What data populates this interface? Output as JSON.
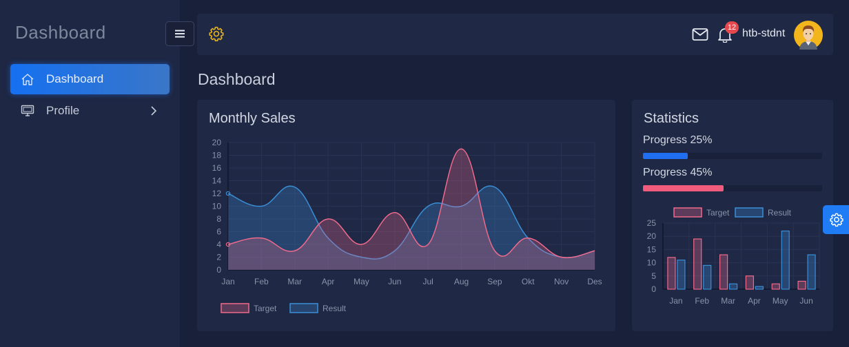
{
  "sidebar": {
    "brand": "Dashboard",
    "items": [
      {
        "label": "Dashboard",
        "icon": "home-icon",
        "active": true
      },
      {
        "label": "Profile",
        "icon": "monitor-icon",
        "active": false
      }
    ]
  },
  "header": {
    "username": "htb-stdnt",
    "notification_count": "12"
  },
  "page": {
    "title": "Dashboard"
  },
  "sales": {
    "title": "Monthly Sales",
    "legend": [
      "Target",
      "Result"
    ]
  },
  "stats": {
    "title": "Statistics",
    "progress": [
      {
        "label": "Progress 25%",
        "value": 0.25,
        "color": "#1f6ff0"
      },
      {
        "label": "Progress 45%",
        "value": 0.45,
        "color": "#f15b7c"
      }
    ],
    "legend": [
      "Target",
      "Result"
    ]
  },
  "colors": {
    "accent": "#1f7cf5",
    "target": "#f06a8c",
    "result": "#3a8fd8"
  },
  "chart_data": [
    {
      "type": "area",
      "categories": [
        "Jan",
        "Feb",
        "Mar",
        "Apr",
        "May",
        "Jun",
        "Jul",
        "Aug",
        "Sep",
        "Okt",
        "Nov",
        "Des"
      ],
      "series": [
        {
          "name": "Target",
          "values": [
            4,
            5,
            3,
            8,
            4,
            9,
            4,
            19,
            3,
            5,
            2,
            3
          ]
        },
        {
          "name": "Result",
          "values": [
            12,
            10,
            13,
            5,
            2,
            3,
            10,
            10,
            13,
            5,
            2,
            3
          ]
        }
      ],
      "yticks": [
        0,
        2,
        4,
        6,
        8,
        10,
        12,
        14,
        16,
        18,
        20
      ],
      "ylim": [
        0,
        20
      ],
      "grid": true,
      "legend_position": "bottom-left"
    },
    {
      "type": "bar",
      "categories": [
        "Jan",
        "Feb",
        "Mar",
        "Apr",
        "May",
        "Jun"
      ],
      "series": [
        {
          "name": "Target",
          "values": [
            12,
            19,
            13,
            5,
            2,
            3
          ]
        },
        {
          "name": "Result",
          "values": [
            11,
            9,
            2,
            1,
            22,
            13
          ]
        }
      ],
      "yticks": [
        0,
        5,
        10,
        15,
        20,
        25
      ],
      "ylim": [
        0,
        25
      ],
      "grid": true,
      "legend_position": "top"
    }
  ]
}
